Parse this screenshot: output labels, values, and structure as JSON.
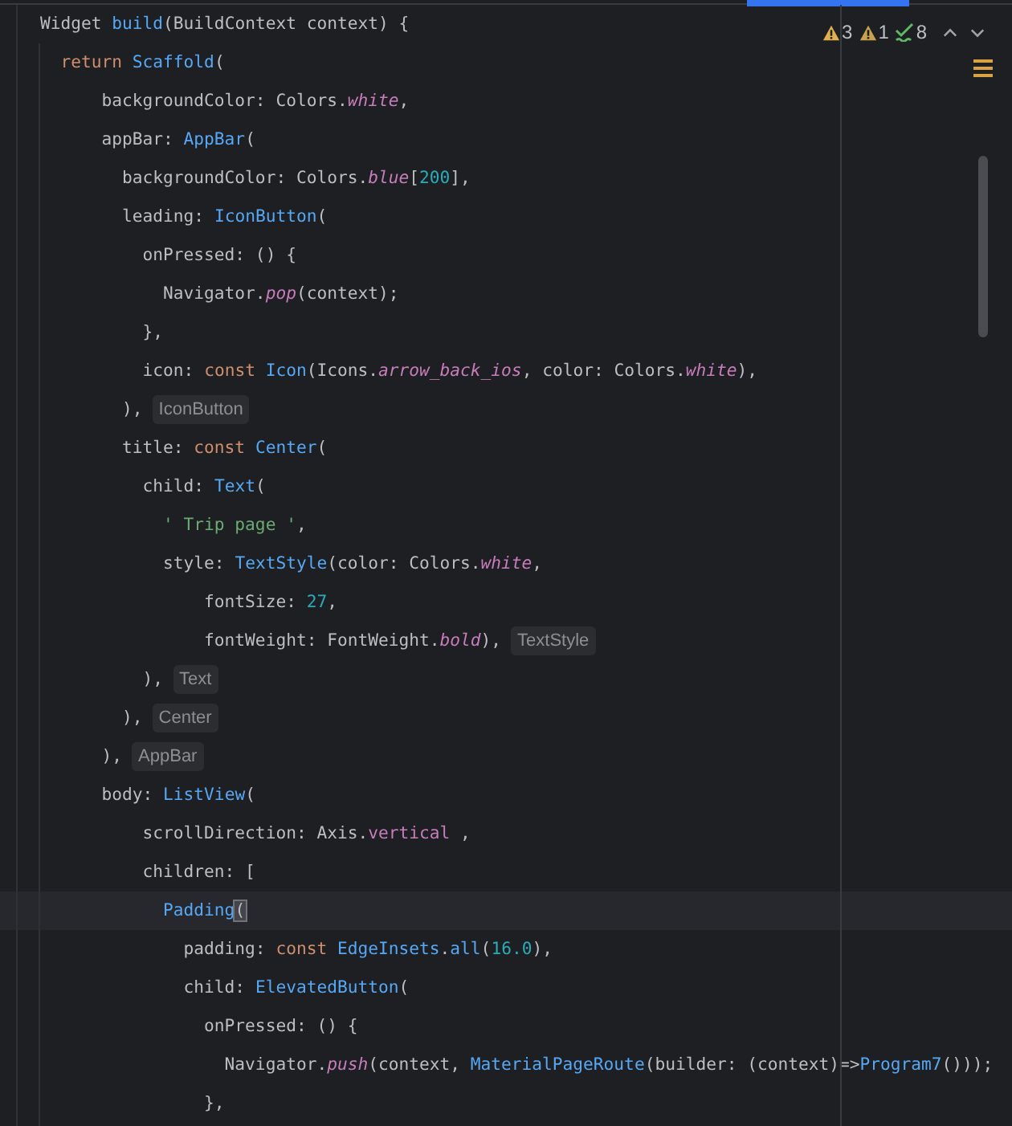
{
  "inspections": {
    "warnings": "3",
    "weak_warnings": "1",
    "typos": "8"
  },
  "lines": [
    {
      "current": false,
      "tokens": [
        {
          "kind": "plain",
          "text": "Widget "
        },
        {
          "kind": "func",
          "text": "build"
        },
        {
          "kind": "plain",
          "text": "(BuildContext context) {"
        }
      ]
    },
    {
      "current": false,
      "tokens": [
        {
          "kind": "kw",
          "text": "  return "
        },
        {
          "kind": "cls",
          "text": "Scaffold"
        },
        {
          "kind": "plain",
          "text": "("
        }
      ]
    },
    {
      "current": false,
      "tokens": [
        {
          "kind": "plain",
          "text": "      backgroundColor: Colors."
        },
        {
          "kind": "member",
          "text": "white"
        },
        {
          "kind": "plain",
          "text": ","
        }
      ]
    },
    {
      "current": false,
      "tokens": [
        {
          "kind": "plain",
          "text": "      appBar: "
        },
        {
          "kind": "cls",
          "text": "AppBar"
        },
        {
          "kind": "plain",
          "text": "("
        }
      ]
    },
    {
      "current": false,
      "tokens": [
        {
          "kind": "plain",
          "text": "        backgroundColor: Colors."
        },
        {
          "kind": "member",
          "text": "blue"
        },
        {
          "kind": "plain",
          "text": "["
        },
        {
          "kind": "num",
          "text": "200"
        },
        {
          "kind": "plain",
          "text": "],"
        }
      ]
    },
    {
      "current": false,
      "tokens": [
        {
          "kind": "plain",
          "text": "        leading: "
        },
        {
          "kind": "cls",
          "text": "IconButton"
        },
        {
          "kind": "plain",
          "text": "("
        }
      ]
    },
    {
      "current": false,
      "tokens": [
        {
          "kind": "plain",
          "text": "          onPressed: () {"
        }
      ]
    },
    {
      "current": false,
      "tokens": [
        {
          "kind": "plain",
          "text": "            Navigator."
        },
        {
          "kind": "method",
          "text": "pop"
        },
        {
          "kind": "plain",
          "text": "(context);"
        }
      ]
    },
    {
      "current": false,
      "tokens": [
        {
          "kind": "plain",
          "text": "          },"
        }
      ]
    },
    {
      "current": false,
      "tokens": [
        {
          "kind": "plain",
          "text": "          icon: "
        },
        {
          "kind": "kw",
          "text": "const "
        },
        {
          "kind": "cls",
          "text": "Icon"
        },
        {
          "kind": "plain",
          "text": "(Icons."
        },
        {
          "kind": "member",
          "text": "arrow_back_ios"
        },
        {
          "kind": "plain",
          "text": ", color: Colors."
        },
        {
          "kind": "member",
          "text": "white"
        },
        {
          "kind": "plain",
          "text": "),"
        }
      ]
    },
    {
      "current": false,
      "hint": "IconButton",
      "tokens": [
        {
          "kind": "plain",
          "text": "        ),"
        }
      ]
    },
    {
      "current": false,
      "tokens": [
        {
          "kind": "plain",
          "text": "        title: "
        },
        {
          "kind": "kw",
          "text": "const "
        },
        {
          "kind": "cls",
          "text": "Center"
        },
        {
          "kind": "plain",
          "text": "("
        }
      ]
    },
    {
      "current": false,
      "tokens": [
        {
          "kind": "plain",
          "text": "          child: "
        },
        {
          "kind": "cls",
          "text": "Text"
        },
        {
          "kind": "plain",
          "text": "("
        }
      ]
    },
    {
      "current": false,
      "tokens": [
        {
          "kind": "str",
          "text": "            ' Trip page '"
        },
        {
          "kind": "plain",
          "text": ","
        }
      ]
    },
    {
      "current": false,
      "tokens": [
        {
          "kind": "plain",
          "text": "            style: "
        },
        {
          "kind": "cls",
          "text": "TextStyle"
        },
        {
          "kind": "plain",
          "text": "(color: Colors."
        },
        {
          "kind": "member",
          "text": "white"
        },
        {
          "kind": "plain",
          "text": ","
        }
      ]
    },
    {
      "current": false,
      "tokens": [
        {
          "kind": "plain",
          "text": "                fontSize: "
        },
        {
          "kind": "num",
          "text": "27"
        },
        {
          "kind": "plain",
          "text": ","
        }
      ]
    },
    {
      "current": false,
      "hint": "TextStyle",
      "tokens": [
        {
          "kind": "plain",
          "text": "                fontWeight: FontWeight."
        },
        {
          "kind": "method",
          "text": "bold"
        },
        {
          "kind": "plain",
          "text": "),"
        }
      ]
    },
    {
      "current": false,
      "hint": "Text",
      "tokens": [
        {
          "kind": "plain",
          "text": "          ),"
        }
      ]
    },
    {
      "current": false,
      "hint": "Center",
      "tokens": [
        {
          "kind": "plain",
          "text": "        ),"
        }
      ]
    },
    {
      "current": false,
      "hint": "AppBar",
      "tokens": [
        {
          "kind": "plain",
          "text": "      ),"
        }
      ]
    },
    {
      "current": false,
      "tokens": [
        {
          "kind": "plain",
          "text": "      body: "
        },
        {
          "kind": "cls",
          "text": "ListView"
        },
        {
          "kind": "plain",
          "text": "("
        }
      ]
    },
    {
      "current": false,
      "tokens": [
        {
          "kind": "plain",
          "text": "          scrollDirection: Axis."
        },
        {
          "kind": "field",
          "text": "vertical"
        },
        {
          "kind": "plain",
          "text": " ,"
        }
      ]
    },
    {
      "current": false,
      "tokens": [
        {
          "kind": "plain",
          "text": "          children: ["
        }
      ]
    },
    {
      "current": true,
      "tokens": [
        {
          "kind": "cls",
          "text": "            Padding"
        },
        {
          "kind": "match",
          "text": "("
        }
      ]
    },
    {
      "current": false,
      "tokens": [
        {
          "kind": "plain",
          "text": "              padding: "
        },
        {
          "kind": "kw",
          "text": "const "
        },
        {
          "kind": "cls",
          "text": "EdgeInsets"
        },
        {
          "kind": "plain",
          "text": "."
        },
        {
          "kind": "cls",
          "text": "all"
        },
        {
          "kind": "plain",
          "text": "("
        },
        {
          "kind": "num",
          "text": "16.0"
        },
        {
          "kind": "plain",
          "text": "),"
        }
      ]
    },
    {
      "current": false,
      "tokens": [
        {
          "kind": "plain",
          "text": "              child: "
        },
        {
          "kind": "cls",
          "text": "ElevatedButton"
        },
        {
          "kind": "plain",
          "text": "("
        }
      ]
    },
    {
      "current": false,
      "tokens": [
        {
          "kind": "plain",
          "text": "                onPressed: () {"
        }
      ]
    },
    {
      "current": false,
      "tokens": [
        {
          "kind": "plain",
          "text": "                  Navigator."
        },
        {
          "kind": "method",
          "text": "push"
        },
        {
          "kind": "plain",
          "text": "(context, "
        },
        {
          "kind": "cls",
          "text": "MaterialPageRoute"
        },
        {
          "kind": "plain",
          "text": "(builder: (context)=>"
        },
        {
          "kind": "cls",
          "text": "Program7"
        },
        {
          "kind": "plain",
          "text": "()));"
        }
      ]
    },
    {
      "current": false,
      "tokens": [
        {
          "kind": "plain",
          "text": "                },"
        }
      ]
    }
  ]
}
